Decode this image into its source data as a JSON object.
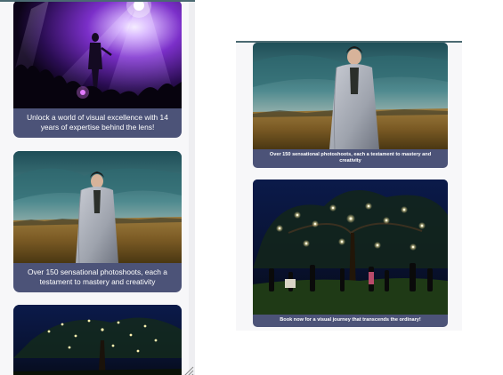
{
  "left_panel": {
    "cards": [
      {
        "image": "concert-stage-photo",
        "caption": "Unlock a world of visual excellence with 14 years of expertise behind the lens!"
      },
      {
        "image": "blanket-portrait-photo",
        "caption": "Over 150 sensational photoshoots, each a testament to mastery and creativity"
      },
      {
        "image": "night-garden-party-photo",
        "caption": ""
      }
    ]
  },
  "right_panel": {
    "cards": [
      {
        "image": "blanket-portrait-photo",
        "caption": "Over 150 sensational photoshoots, each a testament to mastery and creativity"
      },
      {
        "image": "night-garden-party-photo",
        "caption": "Book now for a visual journey that transcends the ordinary!"
      }
    ]
  },
  "colors": {
    "caption_bg": "#4c5378",
    "panel_bg": "#f7f7f9",
    "top_border": "#4b6a72"
  }
}
